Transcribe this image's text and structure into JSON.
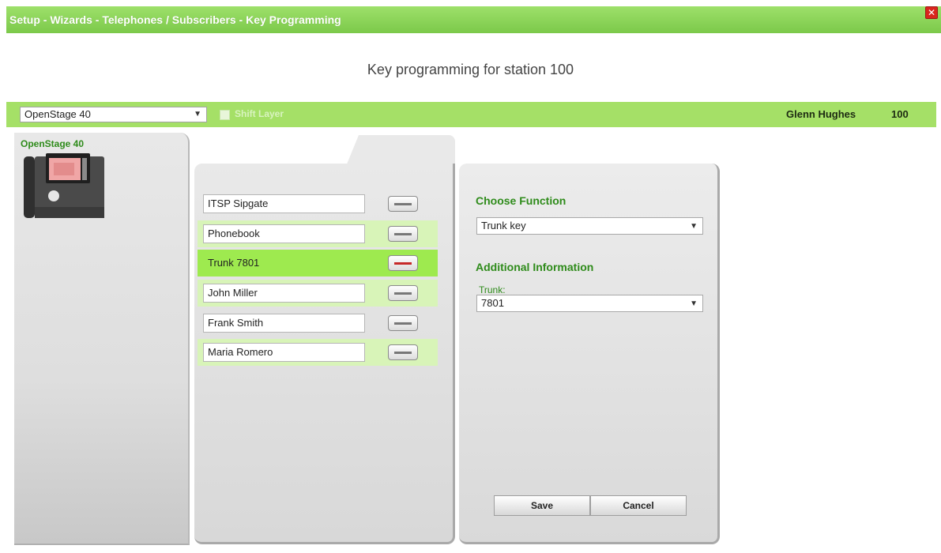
{
  "window": {
    "title": "Setup - Wizards - Telephones / Subscribers - Key Programming",
    "close_icon": "close-icon"
  },
  "heading": "Key programming for station 100",
  "toolbar": {
    "phone_model": "OpenStage 40",
    "shift_layer_label": "Shift Layer",
    "user_name": "Glenn Hughes",
    "user_number": "100"
  },
  "phone_panel": {
    "title": "OpenStage 40"
  },
  "keys": [
    {
      "label": "ITSP Sipgate",
      "state": "normal"
    },
    {
      "label": "Phonebook",
      "state": "alt"
    },
    {
      "label": "Trunk 7801",
      "state": "active"
    },
    {
      "label": "John Miller",
      "state": "alt"
    },
    {
      "label": "Frank Smith",
      "state": "normal"
    },
    {
      "label": "Maria Romero",
      "state": "alt"
    }
  ],
  "function_panel": {
    "choose_function_heading": "Choose Function",
    "function_value": "Trunk key",
    "additional_info_heading": "Additional Information",
    "trunk_label": "Trunk:",
    "trunk_value": "7801",
    "save_label": "Save",
    "cancel_label": "Cancel"
  },
  "colors": {
    "brand_green": "#7cc94a",
    "heading_green": "#2e8b1a",
    "active_row": "#9eea4f",
    "alt_row": "#d8f4b8",
    "active_key_bar": "#c62828",
    "close_red": "#d9251d"
  }
}
